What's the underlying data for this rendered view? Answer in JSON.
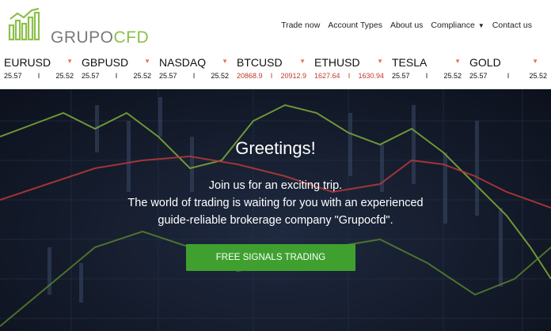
{
  "brand": {
    "name_part1": "GRUPO",
    "name_part2": "CFD",
    "accent": "#8cc04b"
  },
  "nav": {
    "items": [
      "Trade now",
      "Account Types",
      "About us",
      "Compliance",
      "Contact us"
    ],
    "dropdown_icon": "caret-down-icon"
  },
  "ticker": [
    {
      "symbol": "EURUSD",
      "bid": "25.57",
      "ask": "25.52",
      "trend": "down"
    },
    {
      "symbol": "GBPUSD",
      "bid": "25.57",
      "ask": "25.52",
      "trend": "down"
    },
    {
      "symbol": "NASDAQ",
      "bid": "25.57",
      "ask": "25.52",
      "trend": "down"
    },
    {
      "symbol": "BTCUSD",
      "bid": "20868.9",
      "ask": "20912.9",
      "trend": "down"
    },
    {
      "symbol": "ETHUSD",
      "bid": "1627.64",
      "ask": "1630.94",
      "trend": "down"
    },
    {
      "symbol": "TESLA",
      "bid": "25.57",
      "ask": "25.52",
      "trend": "down"
    },
    {
      "symbol": "GOLD",
      "bid": "25.57",
      "ask": "25.52",
      "trend": "down"
    }
  ],
  "ticker_separator": "I",
  "hero": {
    "title": "Greetings!",
    "lines": [
      "Join us for an exciting trip.",
      "The world of trading is waiting for you with an experienced",
      "guide-reliable brokerage company \"Grupocfd\"."
    ],
    "cta_label": "FREE SIGNALS TRADING"
  },
  "colors": {
    "cta": "#3fa02f",
    "hero_bg": "#141b2b",
    "price_down": "#c0392b",
    "arrow": "#e8734a"
  }
}
